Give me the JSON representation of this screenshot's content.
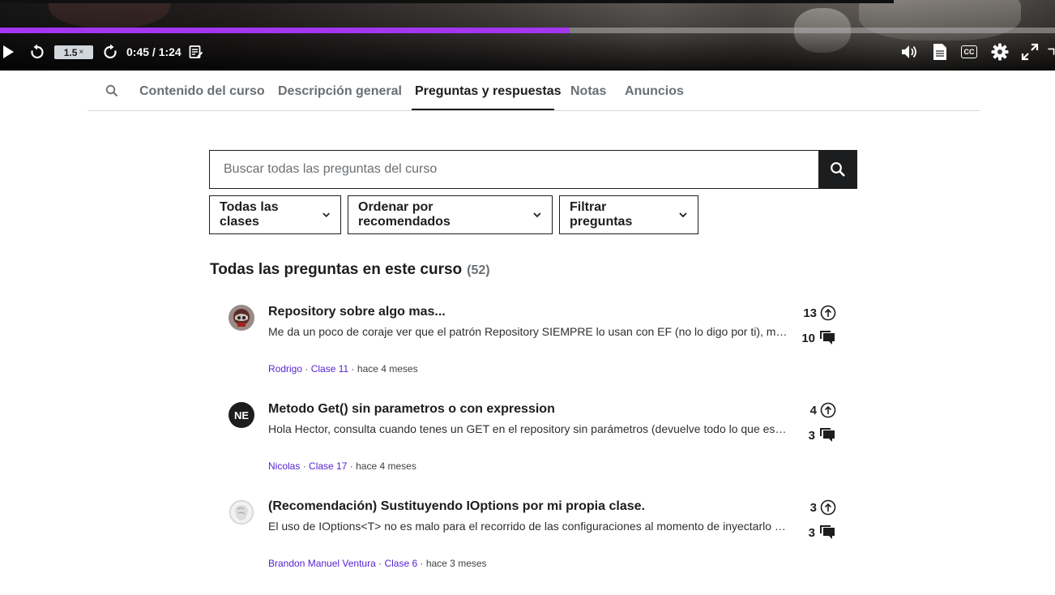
{
  "player": {
    "progress": 0.54,
    "speed": "1.5",
    "speed_suffix": "×",
    "time": "0:45 / 1:24",
    "cc_label": "CC",
    "accent": "#a435f0"
  },
  "tabs": [
    {
      "label": "Contenido del curso",
      "active": false
    },
    {
      "label": "Descripción general",
      "active": false
    },
    {
      "label": "Preguntas y respuestas",
      "active": true
    },
    {
      "label": "Notas",
      "active": false
    },
    {
      "label": "Anuncios",
      "active": false
    }
  ],
  "search": {
    "placeholder": "Buscar todas las preguntas del curso",
    "value": ""
  },
  "filters": [
    {
      "label": "Todas las clases"
    },
    {
      "label": "Ordenar por recomendados"
    },
    {
      "label": "Filtrar preguntas"
    }
  ],
  "heading": {
    "title": "Todas las preguntas en este curso",
    "count": "(52)"
  },
  "questions": [
    {
      "avatar": "photo",
      "initials": "",
      "title": "Repository sobre algo mas...",
      "snippet": "Me da un poco de coraje ver que el patrón Repository SIEMPRE lo usan con EF (no lo digo por ti), me...",
      "author": "Rodrigo",
      "lecture": "Clase 11",
      "time": "hace 4 meses",
      "upvotes": "13",
      "replies": "10"
    },
    {
      "avatar": "initials",
      "initials": "NE",
      "title": "Metodo Get() sin parametros o con expression",
      "snippet": "Hola Hector, consulta cuando tenes un GET en el repository sin parámetros (devuelve todo lo que está...",
      "author": "Nicolas",
      "lecture": "Clase 17",
      "time": "hace 4 meses",
      "upvotes": "4",
      "replies": "3"
    },
    {
      "avatar": "photo",
      "initials": "",
      "title": "(Recomendación) Sustituyendo IOptions por mi propia clase.",
      "snippet": "El uso de IOptions<T> no es malo para el recorrido de las configuraciones al momento de inyectarlo e...",
      "author": "Brandon Manuel Ventura",
      "lecture": "Clase 6",
      "time": "hace 3 meses",
      "upvotes": "3",
      "replies": "3"
    }
  ]
}
